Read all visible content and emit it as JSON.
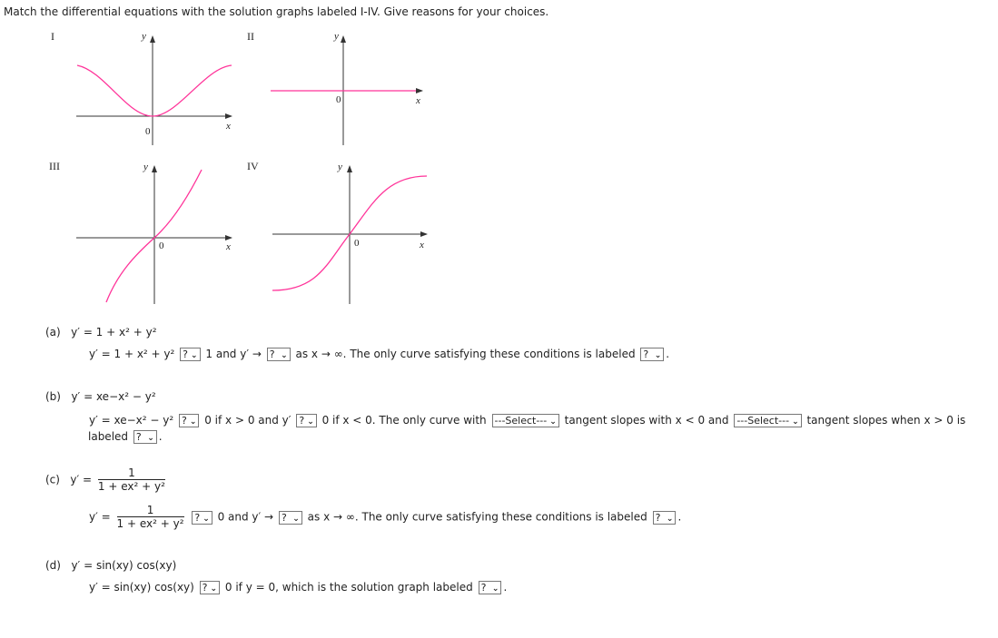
{
  "instructions": "Match the differential equations with the solution graphs labeled I-IV. Give reasons for your choices.",
  "graphs": {
    "labels": [
      "I",
      "II",
      "III",
      "IV"
    ],
    "axis_x": "x",
    "axis_y": "y",
    "origin": "0",
    "curve_color": "#ff3399"
  },
  "parts": {
    "a": {
      "label": "(a)",
      "eq": "y′ = 1 + x² + y²",
      "t1": "1 and y′ →",
      "t2": "as x → ∞.  The only curve satisfying these conditions is labeled",
      "sel1": "?",
      "sel2": "?",
      "sel3": "?"
    },
    "b": {
      "label": "(b)",
      "eq": "y′ = xe−x² − y²",
      "t1": "0 if x > 0 and y′",
      "t2": "0 if x < 0.  The only curve with",
      "t3": "tangent slopes with  x < 0  and",
      "t4": "tangent slopes when  x > 0  is",
      "t5": "labeled",
      "sel1": "?",
      "sel2": "?",
      "sel3": "---Select---",
      "sel4": "---Select---",
      "sel5": "?"
    },
    "c": {
      "label": "(c)",
      "num": "1",
      "den": "1 + ex² + y²",
      "t1": "0 and y′ →",
      "t2": "as x → ∞.  The only curve satisfying these conditions is labeled",
      "sel1": "?",
      "sel2": "?",
      "sel3": "?"
    },
    "d": {
      "label": "(d)",
      "eq": "y′ = sin(xy) cos(xy)",
      "t1": "0 if y = 0,  which is the solution graph labeled",
      "sel1": "?",
      "sel2": "?"
    }
  }
}
